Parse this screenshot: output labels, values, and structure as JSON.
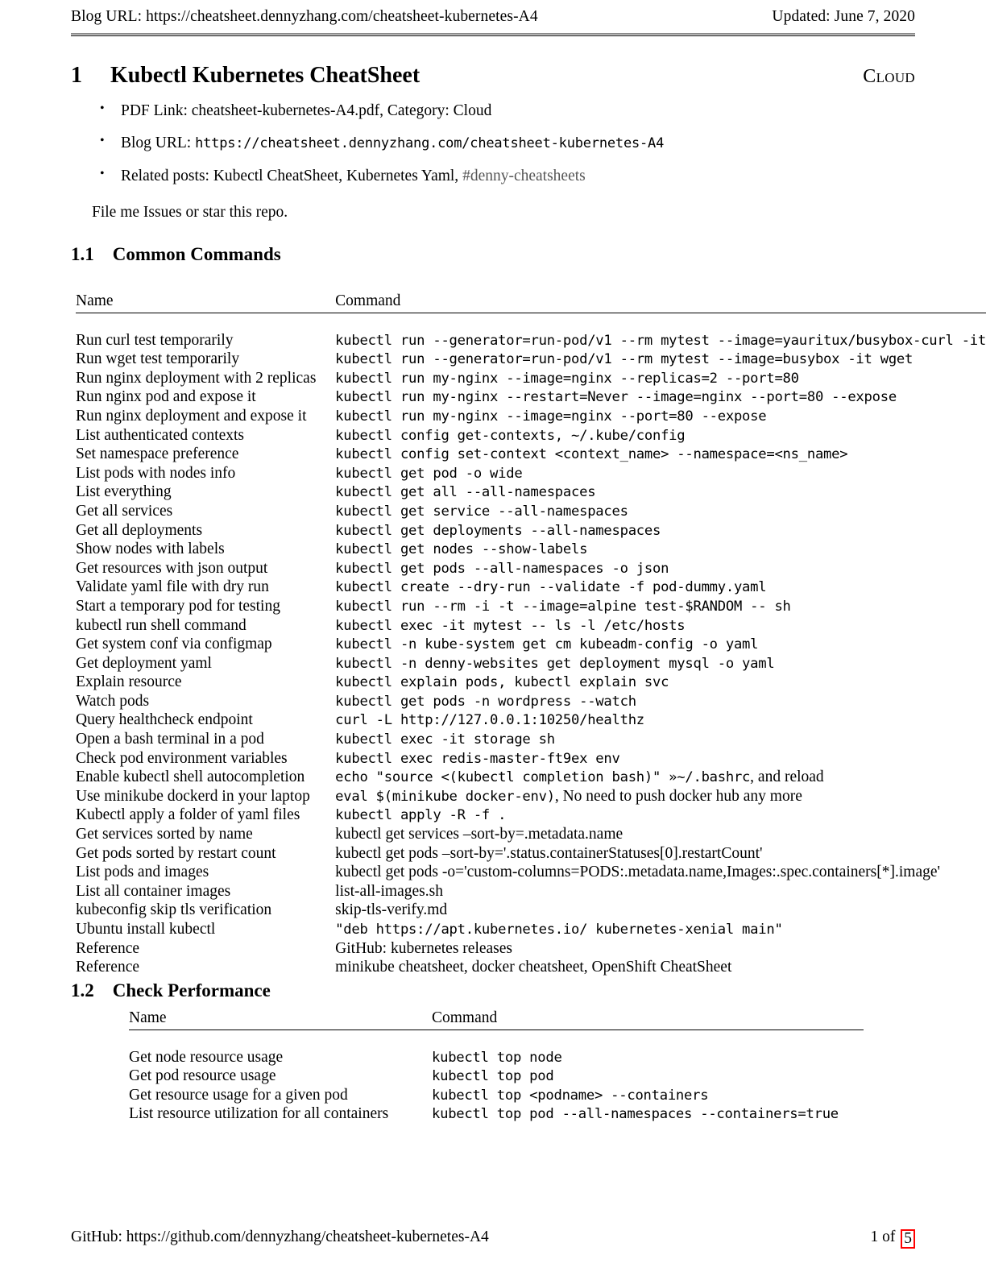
{
  "header": {
    "left": "Blog URL: https://cheatsheet.dennyzhang.com/cheatsheet-kubernetes-A4",
    "right": "Updated: June 7, 2020"
  },
  "title": {
    "number": "1",
    "text": "Kubectl Kubernetes CheatSheet",
    "category": "Cloud"
  },
  "bullets": [
    {
      "label": "PDF Link: ",
      "value": "cheatsheet-kubernetes-A4.pdf, Category: Cloud"
    },
    {
      "label": "Blog URL: ",
      "value": "https://cheatsheet.dennyzhang.com/cheatsheet-kubernetes-A4"
    },
    {
      "label": "Related posts: ",
      "value": "Kubectl CheatSheet, Kubernetes Yaml, ",
      "tag": "#denny-cheatsheets"
    }
  ],
  "note": "File me Issues or star this repo.",
  "sections": [
    {
      "number": "1.1",
      "heading": "Common Commands",
      "columns": [
        "Name",
        "Command"
      ],
      "rows": [
        {
          "name": "Run curl test temporarily",
          "command": "kubectl run --generator=run-pod/v1 --rm mytest --image=yauritux/busybox-curl -it",
          "style": "mono"
        },
        {
          "name": "Run wget test temporarily",
          "command": "kubectl run --generator=run-pod/v1 --rm mytest --image=busybox -it wget",
          "style": "mono"
        },
        {
          "name": "Run nginx deployment with 2 replicas",
          "command": "kubectl run my-nginx --image=nginx --replicas=2 --port=80",
          "style": "mono"
        },
        {
          "name": "Run nginx pod and expose it",
          "command": "kubectl run my-nginx --restart=Never --image=nginx --port=80 --expose",
          "style": "mono"
        },
        {
          "name": "Run nginx deployment and expose it",
          "command": "kubectl run my-nginx --image=nginx --port=80 --expose",
          "style": "mono"
        },
        {
          "name": "List authenticated contexts",
          "command": "kubectl config get-contexts, ~/.kube/config",
          "style": "mono"
        },
        {
          "name": "Set namespace preference",
          "command": "kubectl config set-context <context_name> --namespace=<ns_name>",
          "style": "mono"
        },
        {
          "name": "List pods with nodes info",
          "command": "kubectl get pod -o wide",
          "style": "mono"
        },
        {
          "name": "List everything",
          "command": "kubectl get all --all-namespaces",
          "style": "mono"
        },
        {
          "name": "Get all services",
          "command": "kubectl get service --all-namespaces",
          "style": "mono"
        },
        {
          "name": "Get all deployments",
          "command": "kubectl get deployments --all-namespaces",
          "style": "mono"
        },
        {
          "name": "Show nodes with labels",
          "command": "kubectl get nodes --show-labels",
          "style": "mono"
        },
        {
          "name": "Get resources with json output",
          "command": "kubectl get pods --all-namespaces -o json",
          "style": "mono"
        },
        {
          "name": "Validate yaml file with dry run",
          "command": "kubectl create --dry-run --validate -f pod-dummy.yaml",
          "style": "mono"
        },
        {
          "name": "Start a temporary pod for testing",
          "command": "kubectl run --rm -i -t --image=alpine test-$RANDOM -- sh",
          "style": "mono"
        },
        {
          "name": "kubectl run shell command",
          "command": "kubectl exec -it mytest -- ls -l /etc/hosts",
          "style": "mono"
        },
        {
          "name": "Get system conf via configmap",
          "command": "kubectl -n kube-system get cm kubeadm-config -o yaml",
          "style": "mono"
        },
        {
          "name": "Get deployment yaml",
          "command": "kubectl -n denny-websites get deployment mysql -o yaml",
          "style": "mono"
        },
        {
          "name": "Explain resource",
          "command": "kubectl explain pods, kubectl explain svc",
          "style": "mono"
        },
        {
          "name": "Watch pods",
          "command": "kubectl get pods -n wordpress --watch",
          "style": "mono"
        },
        {
          "name": "Query healthcheck endpoint",
          "command": "curl -L http://127.0.0.1:10250/healthz",
          "style": "mono"
        },
        {
          "name": "Open a bash terminal in a pod",
          "command": "kubectl exec -it storage sh",
          "style": "mono"
        },
        {
          "name": "Check pod environment variables",
          "command": "kubectl exec redis-master-ft9ex env",
          "style": "mono"
        },
        {
          "name": "Enable kubectl shell autocompletion",
          "command": "echo \"source <(kubectl completion bash)\" »~/.bashrc",
          "command_tail": ", and reload",
          "style": "mixed"
        },
        {
          "name": "Use minikube dockerd in your laptop",
          "command": "eval $(minikube docker-env)",
          "command_tail": ", No need to push docker hub any more",
          "style": "mixed"
        },
        {
          "name": "Kubectl apply a folder of yaml files",
          "command": "kubectl apply -R -f .",
          "style": "mono"
        },
        {
          "name": "Get services sorted by name",
          "command": "kubectl get services –sort-by=.metadata.name",
          "style": "serif"
        },
        {
          "name": "Get pods sorted by restart count",
          "command": "kubectl get pods –sort-by='.status.containerStatuses[0].restartCount'",
          "style": "serif"
        },
        {
          "name": "List pods and images",
          "command": "kubectl get pods -o='custom-columns=PODS:.metadata.name,Images:.spec.containers[*].image'",
          "style": "serif"
        },
        {
          "name": "List all container images",
          "command": "list-all-images.sh",
          "style": "serif"
        },
        {
          "name": "kubeconfig skip tls verification",
          "command": "skip-tls-verify.md",
          "style": "serif"
        },
        {
          "name": "Ubuntu install kubectl",
          "command": "\"deb https://apt.kubernetes.io/ kubernetes-xenial main\"",
          "style": "mono"
        },
        {
          "name": "Reference",
          "command": "GitHub: kubernetes releases",
          "style": "serif"
        },
        {
          "name": "Reference",
          "command": "minikube cheatsheet, docker cheatsheet, OpenShift CheatSheet",
          "style": "serif"
        }
      ]
    },
    {
      "number": "1.2",
      "heading": "Check Performance",
      "columns": [
        "Name",
        "Command"
      ],
      "rows": [
        {
          "name": "Get node resource usage",
          "command": "kubectl top node",
          "style": "mono"
        },
        {
          "name": "Get pod resource usage",
          "command": "kubectl top pod",
          "style": "mono"
        },
        {
          "name": "Get resource usage for a given pod",
          "command": "kubectl top <podname> --containers",
          "style": "mono"
        },
        {
          "name": "List resource utilization for all containers",
          "command": "kubectl top pod --all-namespaces --containers=true",
          "style": "mono"
        }
      ]
    }
  ],
  "footer": {
    "left": "GitHub: https://github.com/dennyzhang/cheatsheet-kubernetes-A4",
    "page_prefix": "1 of ",
    "page_total": "5",
    "page_box_color": "#ff0000"
  }
}
